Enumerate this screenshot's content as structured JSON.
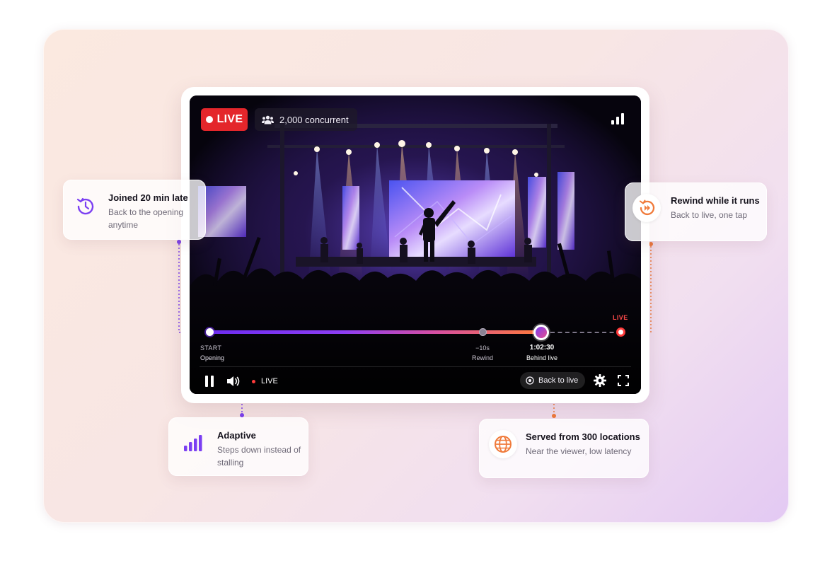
{
  "player": {
    "live_badge": "LIVE",
    "concurrent": "2,000 concurrent",
    "live_end_label": "LIVE",
    "timeline": {
      "start_label": "START",
      "start_sub": "Opening",
      "rewind_label": "−10s",
      "rewind_sub": "Rewind",
      "position_time": "1:02:30",
      "position_sub": "Behind live",
      "progress_fraction": 0.8
    },
    "controls": {
      "live_label": "LIVE",
      "back_to_live": "Back to live"
    }
  },
  "callouts": {
    "joined": {
      "title": "Joined 20 min late",
      "desc": "Back to the opening anytime",
      "icon": "clock-rewind-icon"
    },
    "rewind": {
      "title": "Rewind while it runs",
      "desc": "Back to live, one tap",
      "icon": "rewind-play-icon"
    },
    "adaptive": {
      "title": "Adaptive",
      "desc": "Steps down instead of stalling",
      "icon": "bars-icon"
    },
    "served": {
      "title": "Served from 300 locations",
      "desc": "Near the viewer, low latency",
      "icon": "globe-icon"
    }
  },
  "colors": {
    "live_red": "#e4262b",
    "accent_purple": "#6d2cf0",
    "accent_orange": "#f07a3a"
  }
}
